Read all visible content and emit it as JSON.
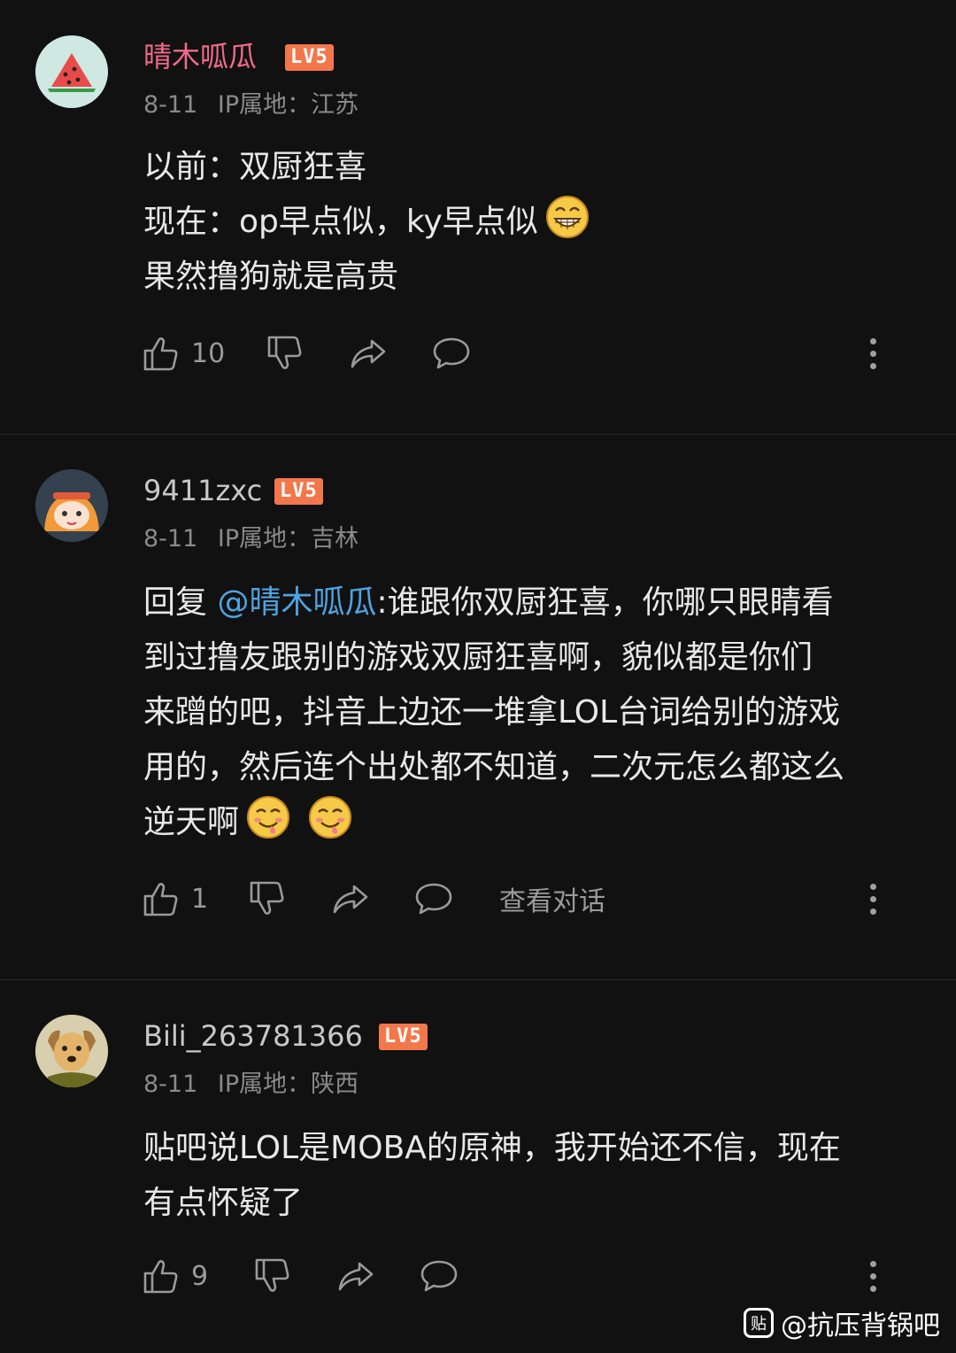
{
  "comments": [
    {
      "username": "晴木呱瓜",
      "username_color": "#f06b8a",
      "level": "LV5",
      "date": "8-11",
      "ip_label": "IP属地：",
      "ip_location": "江苏",
      "lines": [
        "以前：双厨狂喜",
        "现在：op早点似，ky早点似",
        "果然撸狗就是高贵"
      ],
      "line2_emoji": "grinning-emoji",
      "likes": "10",
      "avatar": "watermelon-avatar"
    },
    {
      "username": "9411zxc",
      "username_color": "#c8c8c8",
      "level": "LV5",
      "date": "8-11",
      "ip_label": "IP属地：",
      "ip_location": "吉林",
      "reply_prefix": "回复 ",
      "mention": "@晴木呱瓜",
      "lines": [
        ":谁跟你双厨狂喜，你哪只眼睛看",
        "到过撸友跟别的游戏双厨狂喜啊，貌似都是你们",
        "来蹭的吧，抖音上边还一堆拿LOL台词给别的游戏",
        "用的，然后连个出处都不知道，二次元怎么都这么",
        "逆天啊"
      ],
      "last_emojis": [
        "drooling-emoji",
        "drooling-emoji"
      ],
      "likes": "1",
      "view_conversation": "查看对话",
      "avatar": "anime-girl-avatar"
    },
    {
      "username": "Bili_263781366",
      "username_color": "#c8c8c8",
      "level": "LV5",
      "date": "8-11",
      "ip_label": "IP属地：",
      "ip_location": "陕西",
      "lines": [
        "贴吧说LOL是MOBA的原神，我开始还不信，现在",
        "有点怀疑了"
      ],
      "likes": "9",
      "avatar": "dog-avatar"
    }
  ],
  "watermark": {
    "logo": "贴",
    "text": "@抗压背锅吧"
  },
  "colors": {
    "background": "#111111",
    "level_badge": "#f2774a",
    "mention": "#4fa3e0",
    "meta": "#8a8a8a"
  }
}
